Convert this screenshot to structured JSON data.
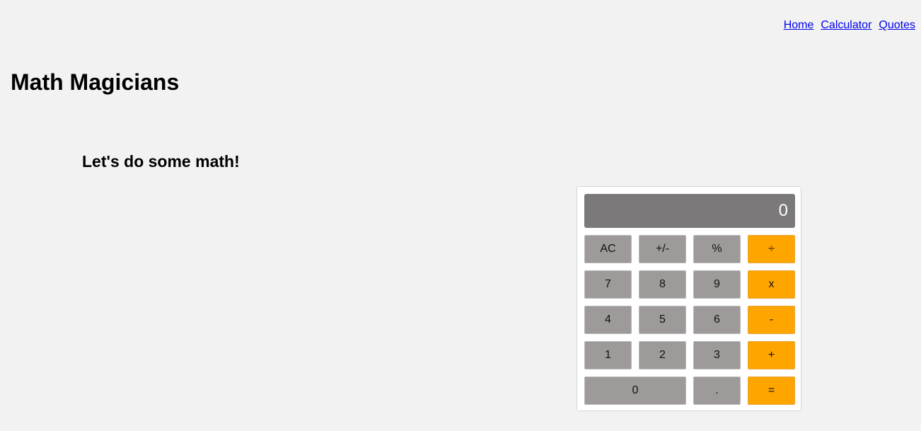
{
  "nav": {
    "home": "Home",
    "calculator": "Calculator",
    "quotes": "Quotes"
  },
  "header": {
    "title": "Math Magicians"
  },
  "main": {
    "subtitle": "Let's do some math!"
  },
  "calculator": {
    "display": "0",
    "buttons": {
      "ac": "AC",
      "sign": "+/-",
      "percent": "%",
      "divide": "÷",
      "seven": "7",
      "eight": "8",
      "nine": "9",
      "multiply": "x",
      "four": "4",
      "five": "5",
      "six": "6",
      "minus": "-",
      "one": "1",
      "two": "2",
      "three": "3",
      "plus": "+",
      "zero": "0",
      "decimal": ".",
      "equals": "="
    },
    "colors": {
      "digit_button": "#9e9a99",
      "operator_button": "#ffa500",
      "display_background": "#7b7979",
      "page_background": "#f2f2f2"
    }
  }
}
